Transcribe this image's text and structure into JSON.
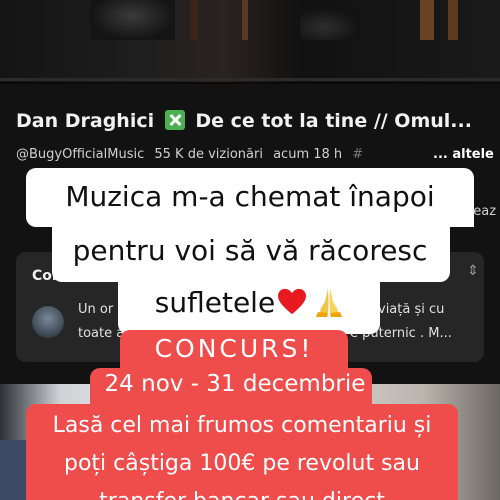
{
  "video": {
    "title_part1": "Dan Draghici",
    "title_part2": "De ce tot la tine // Omul...",
    "title_icon": "x-mark-icon",
    "channel": "@BugyOfficialMusic",
    "views": "55 K de vizionări",
    "age": "acum 18 h",
    "hashtag_fragment": "#",
    "more_label": "... altele",
    "side_fragment": "xeaz"
  },
  "comments": {
    "header": "Comenta",
    "line1_left": "Un or",
    "line1_right": "viață și cu",
    "line2_left": "toate a",
    "line2_right": "e puternic . M..."
  },
  "caption_white": {
    "line1": "Muzica m-a chemat înapoi",
    "line2": "pentru voi să vă răcoresc",
    "line3": "sufletele",
    "icons": [
      "red-heart-icon",
      "praying-hands-icon"
    ]
  },
  "caption_red": {
    "line1": "CONCURS!",
    "line2": "24 nov - 31 decembrie",
    "line3": "Lasă cel mai frumos comentariu și",
    "line4": "poți câștiga 100€ pe revolut sau",
    "line5": "transfer bancar sau direct"
  },
  "colors": {
    "caption_red": "#ef4c4c",
    "caption_white": "#ffffff",
    "verified_green": "#4caf50",
    "background": "#121212"
  }
}
